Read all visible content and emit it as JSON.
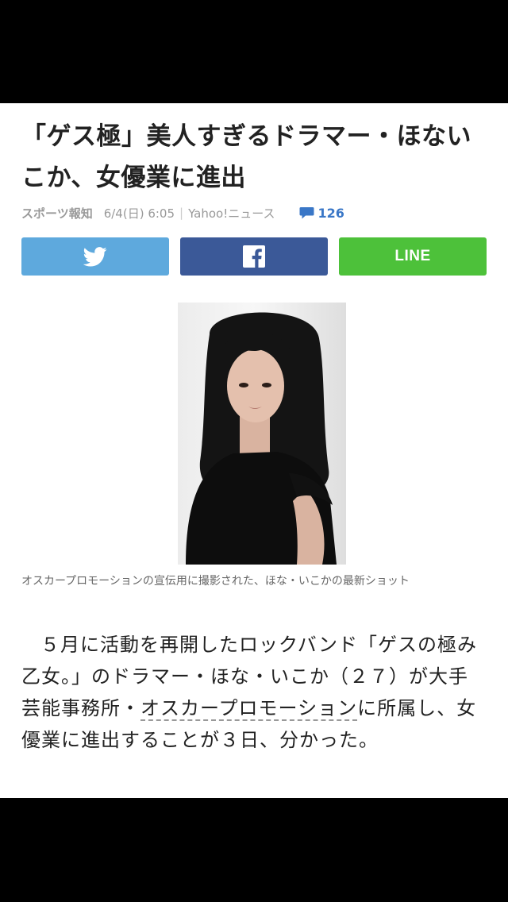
{
  "article": {
    "headline": "「ゲス極」美人すぎるドラマー・ほないこか、女優業に進出",
    "source": "スポーツ報知",
    "date": "6/4(日) 6:05",
    "separator": "|",
    "provider": "Yahoo!ニュース",
    "comment_count": "126",
    "photo_caption": "オスカープロモーションの宣伝用に撮影された、ほな・いこかの最新ショット",
    "body_before_link": "５月に活動を再開したロックバンド「ゲスの極み乙女。」のドラマー・ほな・いこか（２７）が大手芸能事務所・",
    "body_link": "オスカープロモーション",
    "body_after_link": "に所属し、女優業に進出することが３日、分かった。"
  },
  "share": {
    "twitter_icon": "twitter-bird-icon",
    "facebook_icon": "facebook-f-icon",
    "line_label": "LINE"
  },
  "colors": {
    "twitter": "#5ea9dd",
    "facebook": "#3b5998",
    "line": "#4dc13a",
    "comment_accent": "#3a77c7"
  }
}
